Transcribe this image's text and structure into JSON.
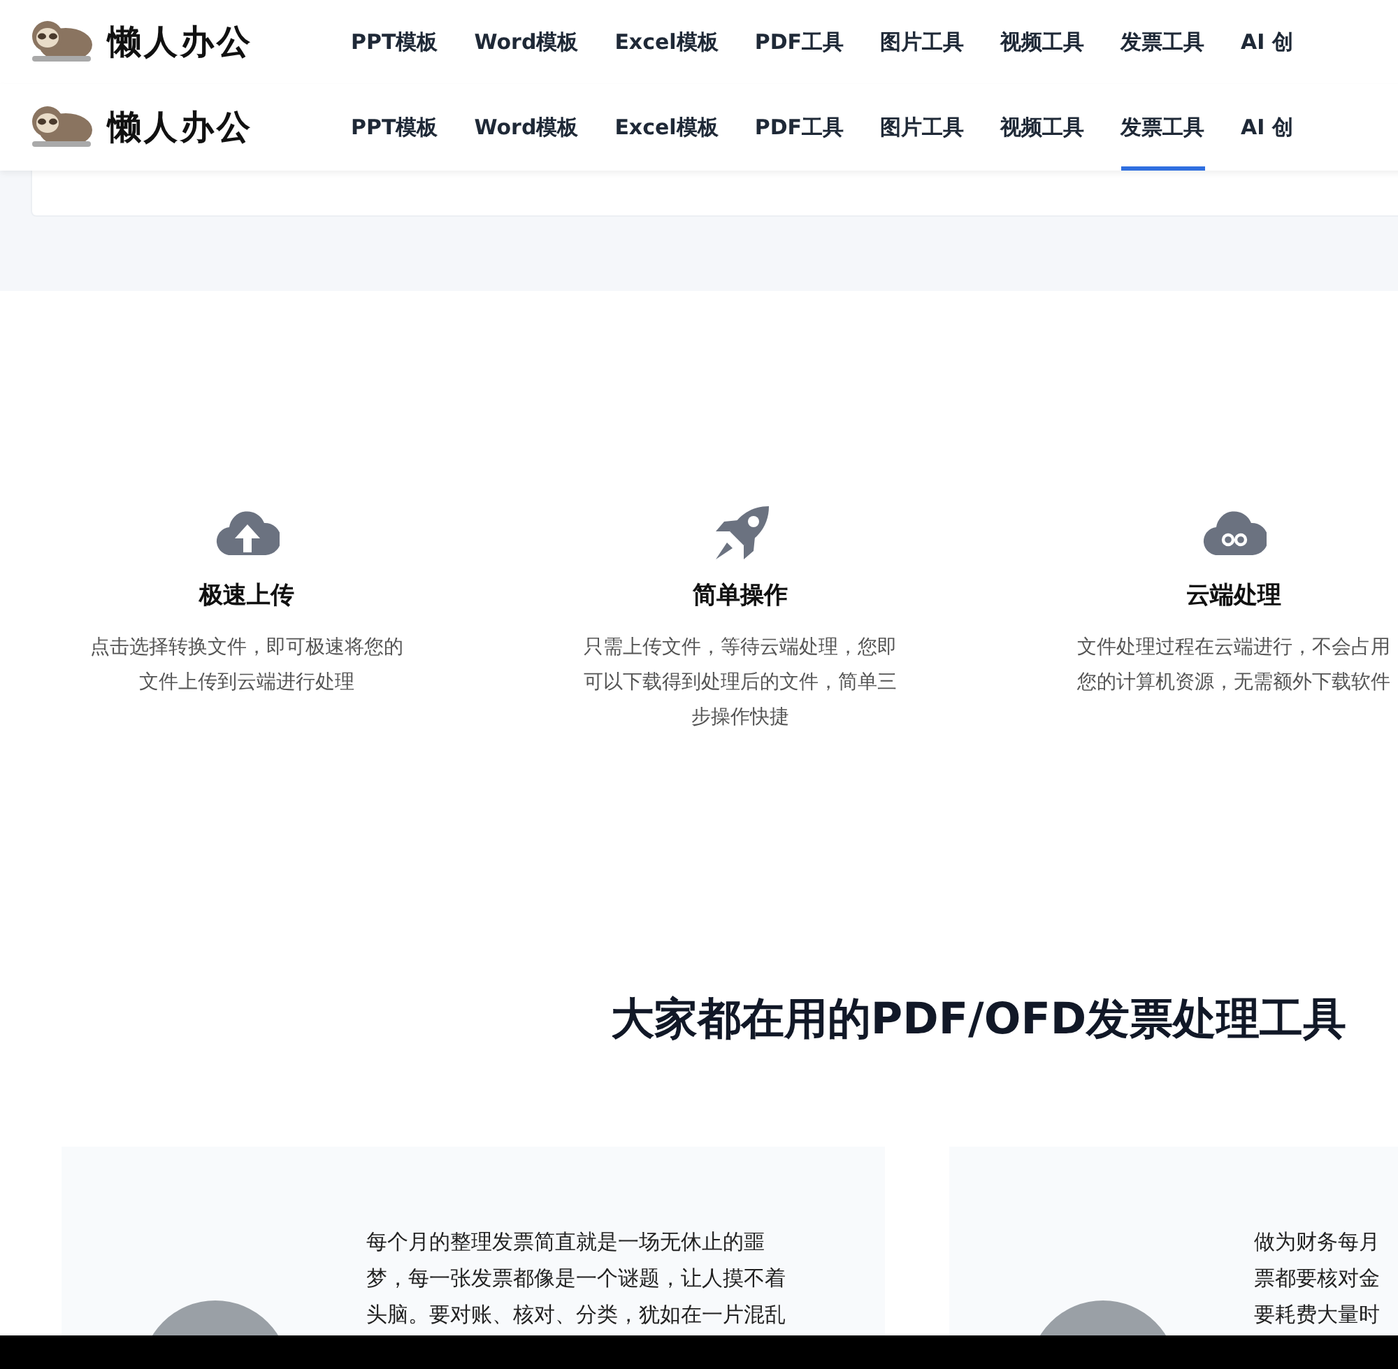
{
  "headers": [
    {
      "logo": "懒人办公",
      "nav": [
        {
          "label": "PPT模板",
          "selected": false
        },
        {
          "label": "Word模板",
          "selected": false
        },
        {
          "label": "Excel模板",
          "selected": false
        },
        {
          "label": "PDF工具",
          "selected": false
        },
        {
          "label": "图片工具",
          "selected": false
        },
        {
          "label": "视频工具",
          "selected": false
        },
        {
          "label": "发票工具",
          "selected": false
        },
        {
          "label": "AI 创",
          "selected": false
        }
      ]
    },
    {
      "logo": "懒人办公",
      "nav": [
        {
          "label": "PPT模板",
          "selected": false
        },
        {
          "label": "Word模板",
          "selected": false
        },
        {
          "label": "Excel模板",
          "selected": false
        },
        {
          "label": "PDF工具",
          "selected": false
        },
        {
          "label": "图片工具",
          "selected": false
        },
        {
          "label": "视频工具",
          "selected": false
        },
        {
          "label": "发票工具",
          "selected": true
        },
        {
          "label": "AI 创",
          "selected": false
        }
      ]
    }
  ],
  "features": [
    {
      "kind": "upload",
      "title": "极速上传",
      "text": "点击选择转换文件，即可极速将您的文件上传到云端进行处理"
    },
    {
      "kind": "rocket",
      "title": "简单操作",
      "text": "只需上传文件，等待云端处理，您即可以下载得到处理后的文件，简单三步操作快捷"
    },
    {
      "kind": "cloud",
      "title": "云端处理",
      "text": "文件处理过程在云端进行，不会占用您的计算机资源，无需额外下载软件"
    }
  ],
  "section_title": "大家都在用的PDF/OFD发票处理工具",
  "testimonials": [
    {
      "lines": [
        "每个月的整理发票简直就是一场无休止的噩",
        "梦，每一张发票都像是一个谜题，让人摸不着",
        "头脑。要对账、核对、分类，犹如在一片混乱"
      ]
    },
    {
      "lines": [
        "做为财务每月",
        "票都要核对金",
        "要耗费大量时"
      ]
    }
  ]
}
